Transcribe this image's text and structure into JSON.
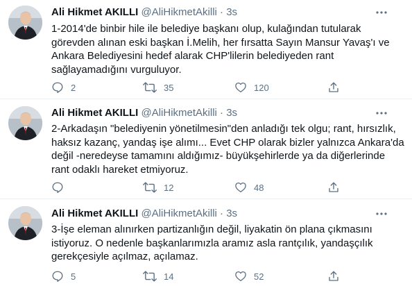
{
  "colors": {
    "icon": "#5b7083",
    "text": "#0f1419",
    "divider": "#ebeef0"
  },
  "tweets": [
    {
      "name": "Ali Hikmet AKILLI",
      "handle": "@AliHikmetAkilli",
      "dot": "·",
      "time": "3s",
      "lines": [
        "1-2014'de binbir hile ile belediye başkanı olup, kulağından tutularak",
        "görevden alınan eski başkan İ.Melih, her fırsatta Sayın Mansur Yavaş'ı ve",
        "Ankara Belediyesini hedef alarak CHP'lilerin belediyeden rant",
        "sağlayamadığını  vurguluyor."
      ],
      "replies": "2",
      "retweets": "35",
      "likes": "120"
    },
    {
      "name": "Ali Hikmet AKILLI",
      "handle": "@AliHikmetAkilli",
      "dot": "·",
      "time": "3s",
      "lines": [
        "2-Arkadaşın \"belediyenin yönetilmesin\"den anladığı tek olgu; rant, hırsızlık,",
        "haksız kazanç, yandaş işe alımı... Evet CHP olarak bizler yalnızca Ankara'da",
        "değil -neredeyse tamamını aldığımız- büyükşehirlerde ya da diğerlerinde",
        "rant odaklı hareket etmiyoruz."
      ],
      "replies": "",
      "retweets": "12",
      "likes": "48"
    },
    {
      "name": "Ali Hikmet AKILLI",
      "handle": "@AliHikmetAkilli",
      "dot": "·",
      "time": "3s",
      "lines": [
        "3-İşe eleman alınırken partizanlığın değil, liyakatin ön plana çıkmasını",
        "istiyoruz. O nedenle başkanlarımızla aramız asla rantçılık, yandaşçılık",
        "gerekçesiyle açılmaz, açılamaz."
      ],
      "replies": "5",
      "retweets": "14",
      "likes": "52"
    }
  ]
}
